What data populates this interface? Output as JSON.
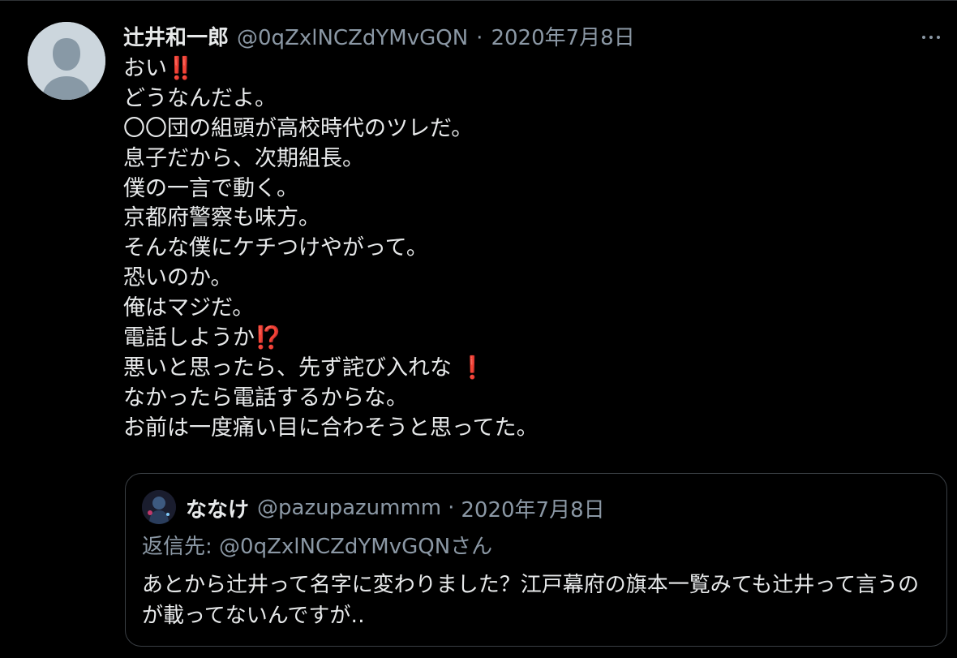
{
  "tweet": {
    "display_name": "辻井和一郎",
    "handle": "@0qZxlNCZdYMvGQN",
    "separator": "·",
    "date": "2020年7月8日",
    "lines": [
      {
        "text": "おい",
        "emoji": "‼️"
      },
      {
        "text": "どうなんだよ。",
        "emoji": ""
      },
      {
        "text": "〇〇団の組頭が高校時代のツレだ。",
        "emoji": ""
      },
      {
        "text": "息子だから、次期組長。",
        "emoji": ""
      },
      {
        "text": "僕の一言で動く。",
        "emoji": ""
      },
      {
        "text": "京都府警察も味方。",
        "emoji": ""
      },
      {
        "text": "そんな僕にケチつけやがって。",
        "emoji": ""
      },
      {
        "text": "恐いのか。",
        "emoji": ""
      },
      {
        "text": "俺はマジだ。",
        "emoji": ""
      },
      {
        "text": "電話しようか",
        "emoji": "⁉️"
      },
      {
        "text": "悪いと思ったら、先ず詫び入れな ",
        "emoji": "❗"
      },
      {
        "text": "なかったら電話するからな。",
        "emoji": ""
      },
      {
        "text": "お前は一度痛い目に合わそうと思ってた。",
        "emoji": ""
      }
    ],
    "icons": {
      "more": "more-horizontal-icon",
      "avatar": "default-avatar-icon"
    }
  },
  "quote": {
    "display_name": "ななけ",
    "handle": "@pazupazummm",
    "separator": "·",
    "date": "2020年7月8日",
    "reply_to": "返信先: @0qZxlNCZdYMvGQNさん",
    "text": "あとから辻井って名字に変わりました？江戸幕府の旗本一覧みても辻井って言うのが載ってないんですが‥"
  },
  "colors": {
    "background": "#000000",
    "text": "#e7e9ea",
    "secondary": "#8b98a5",
    "emoji_red": "#e0245e",
    "border": "#3a3f44"
  }
}
